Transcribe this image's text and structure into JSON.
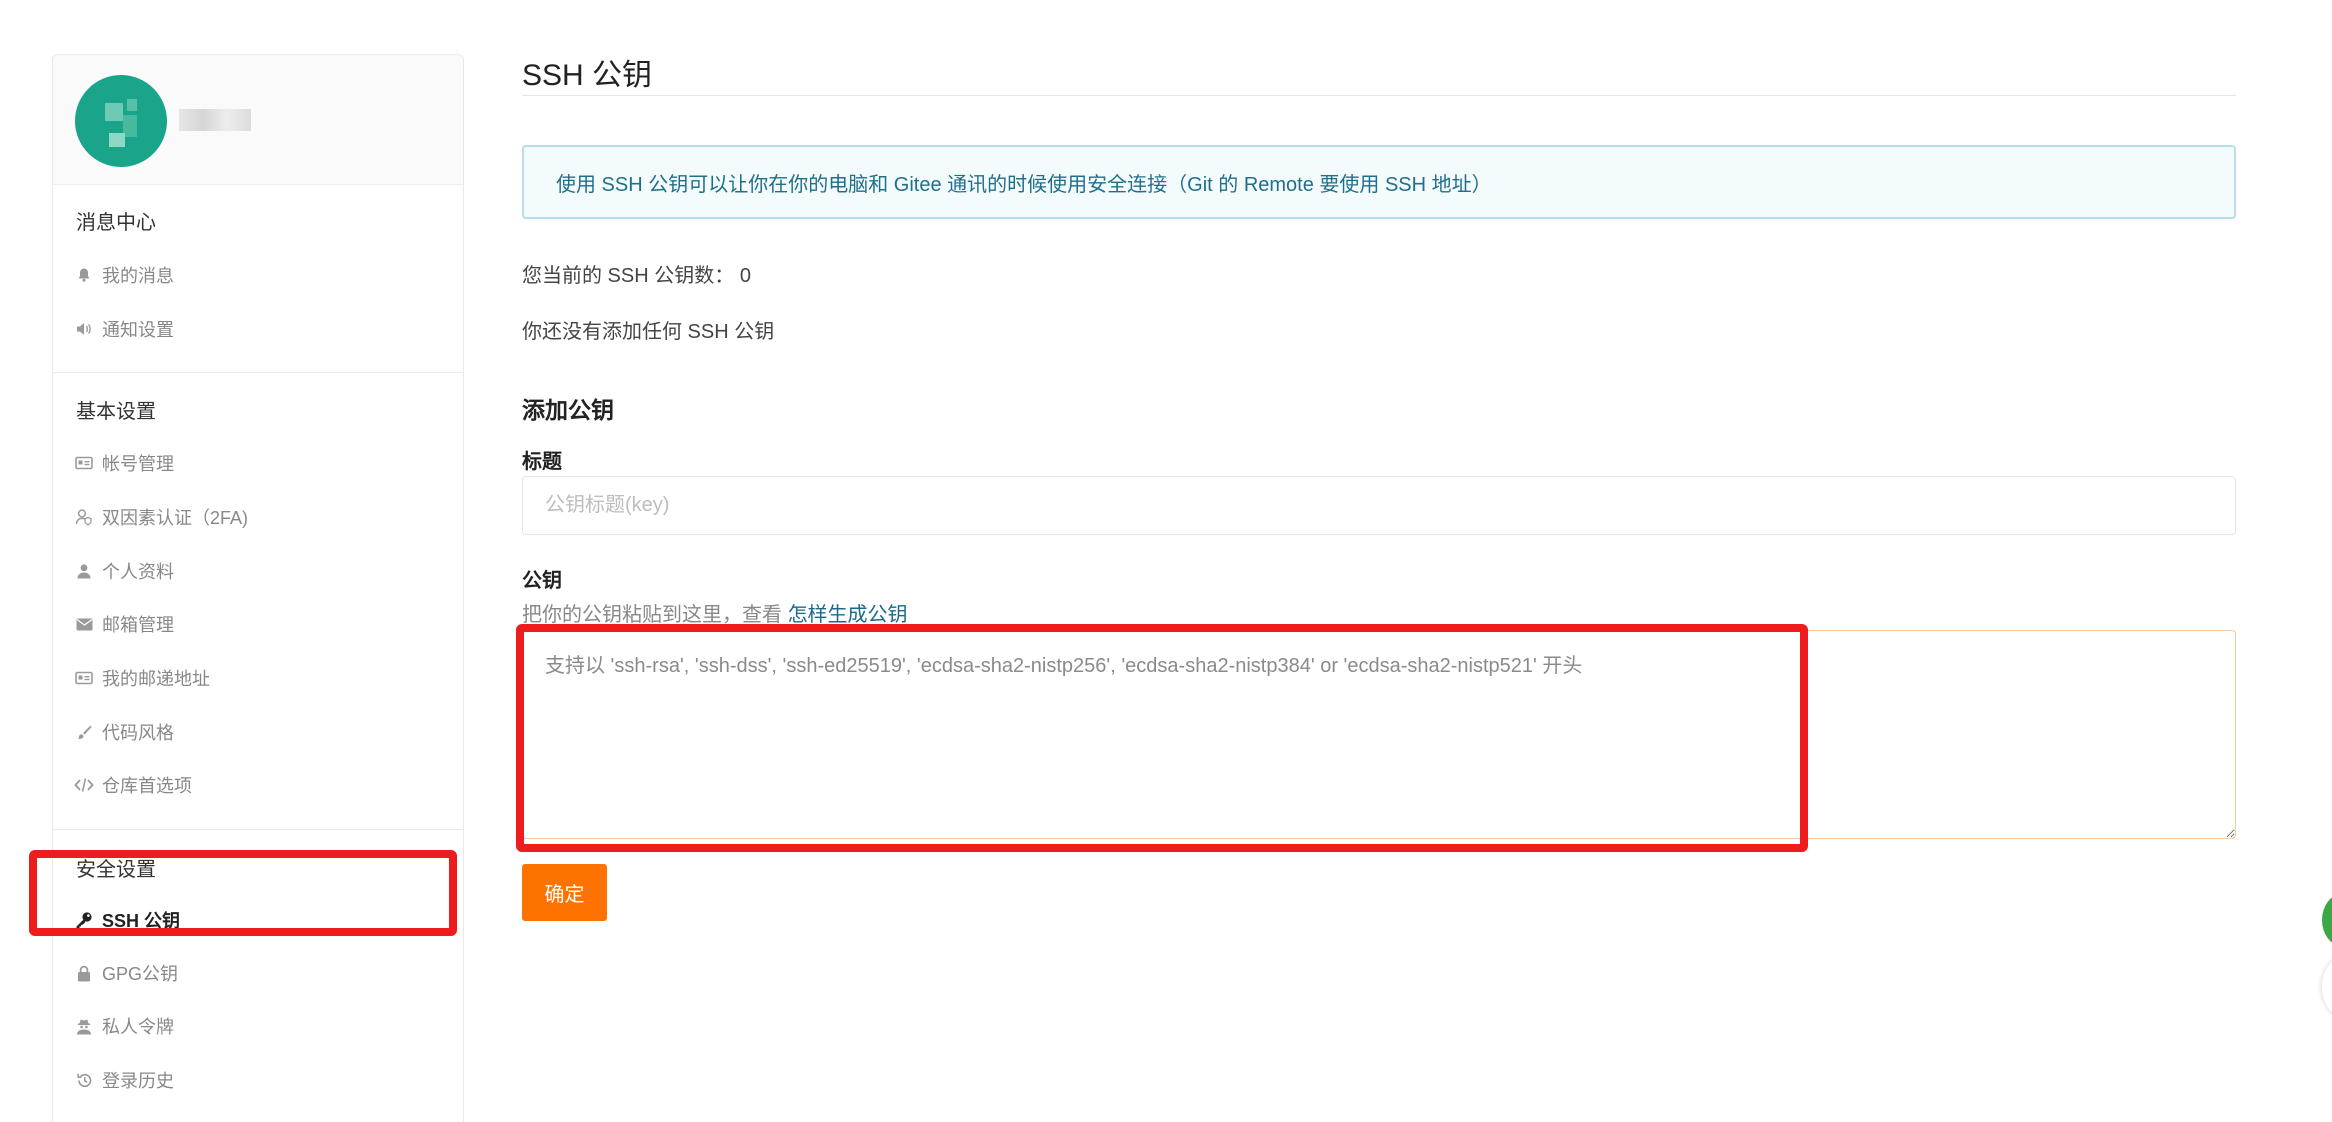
{
  "sidebar": {
    "sections": {
      "messages": {
        "title": "消息中心",
        "items": [
          "我的消息",
          "通知设置"
        ]
      },
      "basic": {
        "title": "基本设置",
        "items": [
          "帐号管理",
          "双因素认证（2FA)",
          "个人资料",
          "邮箱管理",
          "我的邮递地址",
          "代码风格",
          "仓库首选项"
        ]
      },
      "security": {
        "title": "安全设置",
        "items": [
          "SSH 公钥",
          "GPG公钥",
          "私人令牌",
          "登录历史"
        ]
      }
    },
    "icons": {
      "my_messages": "bell-icon",
      "notify_settings": "speaker-icon",
      "account": "id-card-icon",
      "two_factor": "user-shield-icon",
      "profile": "user-icon",
      "email": "envelope-icon",
      "address": "id-card-icon",
      "code_style": "brush-icon",
      "repo_prefs": "code-icon",
      "ssh": "key-icon",
      "gpg": "lock-icon",
      "token": "user-secret-icon",
      "history": "history-icon"
    }
  },
  "main": {
    "title": "SSH 公钥",
    "info": "使用 SSH 公钥可以让你在你的电脑和 Gitee 通讯的时候使用安全连接（Git 的 Remote 要使用 SSH 地址）",
    "count_label": "您当前的 SSH 公钥数：",
    "count_value": "0",
    "empty_text": "你还没有添加任何 SSH 公钥",
    "add_heading": "添加公钥",
    "title_label": "标题",
    "title_placeholder": "公钥标题(key)",
    "key_label": "公钥",
    "key_hint": "把你的公钥粘贴到这里，查看",
    "key_hint_link": "怎样生成公钥",
    "key_placeholder": "支持以 'ssh-rsa', 'ssh-dss', 'ssh-ed25519', 'ecdsa-sha2-nistp256', 'ecdsa-sha2-nistp384' or 'ecdsa-sha2-nistp521' 开头",
    "submit_label": "确定"
  },
  "colors": {
    "accent": "#fe7300",
    "info_text": "#1f6f8b",
    "info_border": "#b9dde8",
    "annotation_red": "#ee1c1c",
    "avatar": "#1aa58a"
  }
}
